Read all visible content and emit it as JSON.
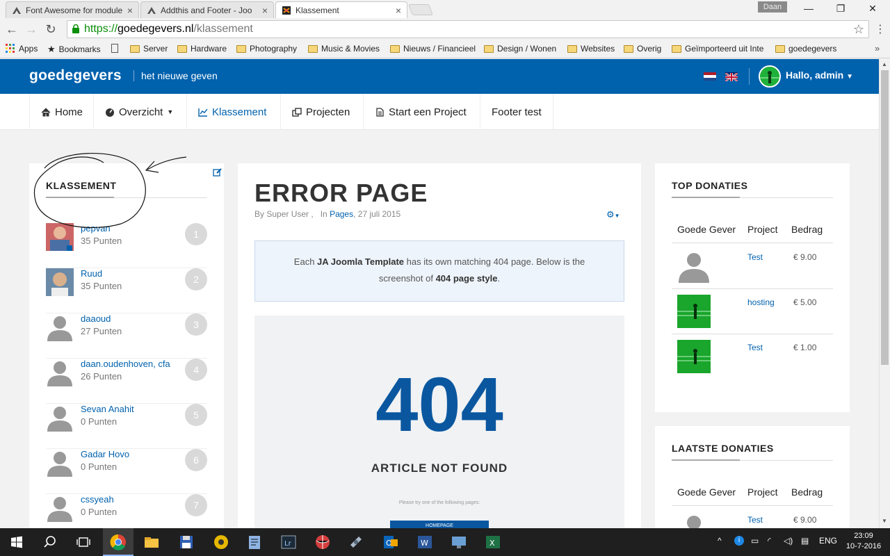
{
  "browser": {
    "tabs": [
      {
        "label": "Font Awesome for module"
      },
      {
        "label": "Addthis and Footer - Joo"
      },
      {
        "label": "Klassement"
      }
    ],
    "profile_name": "Daan",
    "url_scheme": "https://",
    "url_host": "goedegevers.nl",
    "url_path": "/klassement",
    "bookmarks": [
      "Apps",
      "Bookmarks",
      "Server",
      "Hardware",
      "Photography",
      "Music & Movies",
      "Nieuws / Financieel",
      "Design / Wonen",
      "Websites",
      "Overig",
      "Geïmporteerd uit Inte",
      "goedegevers"
    ]
  },
  "site": {
    "logo": "goedegevers",
    "tagline": "het nieuwe geven",
    "greeting": "Hallo, admin",
    "nav": [
      {
        "label": "Home",
        "icon": "home-icon"
      },
      {
        "label": "Overzicht",
        "icon": "dashboard-icon"
      },
      {
        "label": "Klassement",
        "icon": "chart-line-icon"
      },
      {
        "label": "Projecten",
        "icon": "clone-icon"
      },
      {
        "label": "Start een Project",
        "icon": "file-icon"
      },
      {
        "label": "Footer test",
        "icon": ""
      }
    ]
  },
  "klassement": {
    "title": "KLASSEMENT",
    "items": [
      {
        "name": "pepvan",
        "points": "35 Punten",
        "rank": "1"
      },
      {
        "name": "Ruud",
        "points": "35 Punten",
        "rank": "2"
      },
      {
        "name": "daaoud",
        "points": "27 Punten",
        "rank": "3"
      },
      {
        "name": "daan.oudenhoven, cfa",
        "points": "26 Punten",
        "rank": "4"
      },
      {
        "name": "Sevan Anahit",
        "points": "0 Punten",
        "rank": "5"
      },
      {
        "name": "Gadar Hovo",
        "points": "0 Punten",
        "rank": "6"
      },
      {
        "name": "cssyeah",
        "points": "0 Punten",
        "rank": "7"
      }
    ]
  },
  "article": {
    "title": "ERROR PAGE",
    "meta_by": "By Super User ,",
    "meta_in": "In",
    "meta_category": "Pages",
    "meta_date": ", 27 juli 2015",
    "notice_pre": "Each ",
    "notice_bold1": "JA Joomla Template",
    "notice_mid": " has its own matching 404 page. Below is the screenshot of ",
    "notice_bold2": "404 page style",
    "notice_end": ".",
    "code": "404",
    "not_found": "ARTICLE NOT FOUND",
    "try_text": "Please try one of the following pages:",
    "home_button": "HOMEPAGE"
  },
  "top_donaties": {
    "title": "TOP DONATIES",
    "headers": [
      "Goede Gever",
      "Project",
      "Bedrag"
    ],
    "rows": [
      {
        "project": "Test",
        "amount": "€ 9.00",
        "img": "silhouette"
      },
      {
        "project": "hosting",
        "amount": "€ 5.00",
        "img": "green"
      },
      {
        "project": "Test",
        "amount": "€ 1.00",
        "img": "green"
      }
    ]
  },
  "laatste_donaties": {
    "title": "LAATSTE DONATIES",
    "headers": [
      "Goede Gever",
      "Project",
      "Bedrag"
    ],
    "rows": [
      {
        "project": "Test",
        "amount": "€ 9.00",
        "img": "silhouette"
      }
    ]
  },
  "taskbar": {
    "language": "ENG",
    "time": "23:09",
    "date": "10-7-2016"
  },
  "colors": {
    "brand_blue": "#0061ad",
    "header_bg": "#0061ad",
    "page_bg": "#f2f2f2"
  }
}
